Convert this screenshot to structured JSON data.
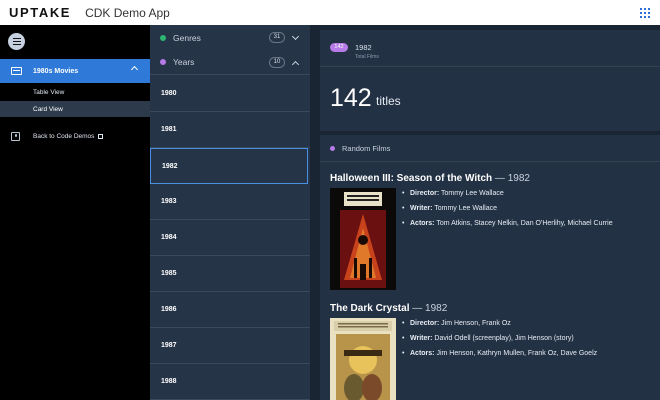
{
  "app": {
    "logo": "UPTAKE",
    "title": "CDK Demo App"
  },
  "sidebar": {
    "active_section": "1980s Movies",
    "sub_items": [
      "Table View",
      "Card View"
    ],
    "back_link": "Back to Code Demos"
  },
  "filters": {
    "genres": {
      "label": "Genres",
      "count": "31",
      "color": "#2bb673"
    },
    "years": {
      "label": "Years",
      "count": "10",
      "color": "#b57be6"
    },
    "year_list": [
      "1980",
      "1981",
      "1982",
      "1983",
      "1984",
      "1985",
      "1986",
      "1987",
      "1988"
    ],
    "selected_year": "1982"
  },
  "summary": {
    "badge": "142",
    "selected_year": "1982",
    "subtitle": "Total Films",
    "big_count": "142",
    "unit": "titles"
  },
  "random_films": {
    "label": "Random Films",
    "films": [
      {
        "title": "Halloween III: Season of the Witch",
        "year": " — 1982",
        "director_label": "Director:",
        "director": " Tommy Lee Wallace",
        "writer_label": "Writer:",
        "writer": " Tommy Lee Wallace",
        "actors_label": "Actors:",
        "actors": " Tom Atkins, Stacey Nelkin, Dan O'Herlihy, Michael Currie"
      },
      {
        "title": "The Dark Crystal",
        "year": " — 1982",
        "director_label": "Director:",
        "director": " Jim Henson, Frank Oz",
        "writer_label": "Writer:",
        "writer": " David Odell (screenplay), Jim Henson (story)",
        "actors_label": "Actors:",
        "actors": " Jim Henson, Kathryn Mullen, Frank Oz, Dave Goelz"
      }
    ]
  },
  "colors": {
    "accent": "#2f7ad9",
    "badge": "#b57be6"
  }
}
